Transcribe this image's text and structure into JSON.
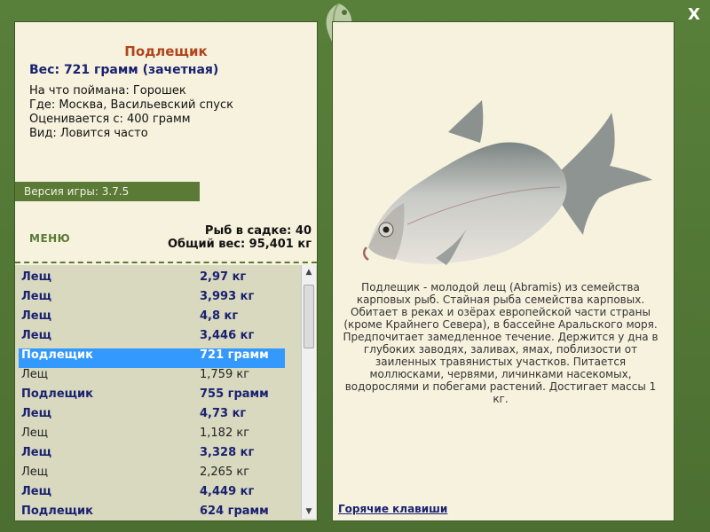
{
  "close_label": "X",
  "fish_card": {
    "title": "Подлещик",
    "weight": "Вес: 721 грамм (зачетная)",
    "bait": "На что поймана: Горошек",
    "location": "Где: Москва, Васильевский спуск",
    "rating": "Оценивается с: 400 грамм",
    "kind": "Вид: Ловится часто"
  },
  "version": "Версия игры: 3.7.5",
  "menu_label": "МЕНЮ",
  "stats": {
    "fish_count": "Рыб в садке: 40",
    "total_weight": "Общий вес: 95,401 кг"
  },
  "catch_list": [
    {
      "name": "Лещ",
      "weight": "2,97 кг",
      "bold": true,
      "selected": false
    },
    {
      "name": "Лещ",
      "weight": "3,993 кг",
      "bold": true,
      "selected": false
    },
    {
      "name": "Лещ",
      "weight": "4,8 кг",
      "bold": true,
      "selected": false
    },
    {
      "name": "Лещ",
      "weight": "3,446 кг",
      "bold": true,
      "selected": false
    },
    {
      "name": "Подлещик",
      "weight": "721 грамм",
      "bold": true,
      "selected": true
    },
    {
      "name": "Лещ",
      "weight": "1,759 кг",
      "bold": false,
      "selected": false
    },
    {
      "name": "Подлещик",
      "weight": "755 грамм",
      "bold": true,
      "selected": false
    },
    {
      "name": "Лещ",
      "weight": "4,73 кг",
      "bold": true,
      "selected": false
    },
    {
      "name": "Лещ",
      "weight": "1,182 кг",
      "bold": false,
      "selected": false
    },
    {
      "name": "Лещ",
      "weight": "3,328 кг",
      "bold": true,
      "selected": false
    },
    {
      "name": "Лещ",
      "weight": "2,265 кг",
      "bold": false,
      "selected": false
    },
    {
      "name": "Лещ",
      "weight": "4,449 кг",
      "bold": true,
      "selected": false
    },
    {
      "name": "Подлещик",
      "weight": "624 грамм",
      "bold": true,
      "selected": false
    }
  ],
  "description": "Подлещик - молодой лещ (Abramis) из семейства карповых рыб. Стайная рыба семейства карповых. Обитает в реках и озёрах европейской части страны (кроме Крайнего Севера), в бассейне Аральского моря. Предпочитает замедленное течение. Держится у дна в глубоких заводях, заливах, ямах, поблизости от заиленных травянистых участков. Питается моллюсками, червями, личинками насекомых, водорослями и побегами растений. Достигает массы 1 кг.",
  "hotkeys_label": "Горячие клавиши",
  "icons": {
    "close": "close-icon",
    "logo": "fish-logo-icon",
    "scroll_up": "scroll-up-icon",
    "scroll_down": "scroll-down-icon"
  },
  "colors": {
    "frame": "#4f7233",
    "panel": "#f6f2de",
    "title": "#b3431a",
    "bold_text": "#1a2170",
    "selection": "#3399ff",
    "list_bg": "#d8d9bf"
  }
}
